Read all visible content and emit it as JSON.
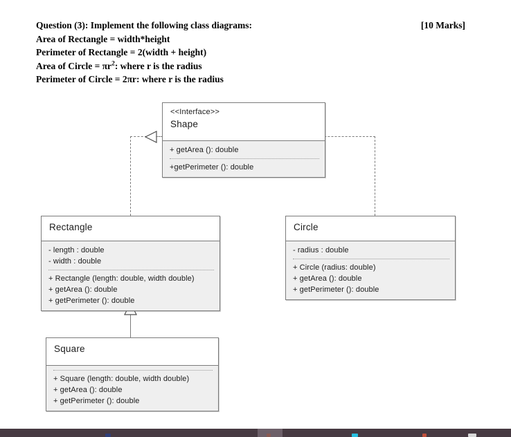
{
  "question": {
    "title": "Question (3): Implement the following class diagrams:",
    "marks": "[10 Marks]",
    "line2": "Area of Rectangle = width*height",
    "line3": "Perimeter of Rectangle = 2(width + height)",
    "line4_prefix": "Area of Circle = πr",
    "line4_sup": "2",
    "line4_suffix": ": where r is the radius",
    "line5": "Perimeter of Circle = 2πr: where r is the radius"
  },
  "diagram": {
    "type": "uml-class-diagram",
    "classes": [
      {
        "id": "shape",
        "stereotype": "<<Interface>>",
        "name": "Shape",
        "attributes": [],
        "methods": [
          "+ getArea (): double",
          "+getPerimeter (): double"
        ]
      },
      {
        "id": "rectangle",
        "stereotype": "",
        "name": "Rectangle",
        "attributes": [
          "- length : double",
          "- width : double"
        ],
        "methods": [
          "+ Rectangle (length: double, width double)",
          "+ getArea (): double",
          "+ getPerimeter (): double"
        ]
      },
      {
        "id": "circle",
        "stereotype": "",
        "name": "Circle",
        "attributes": [
          "- radius : double"
        ],
        "methods": [
          "+ Circle (radius: double)",
          "+ getArea (): double",
          "+ getPerimeter (): double"
        ]
      },
      {
        "id": "square",
        "stereotype": "",
        "name": "Square",
        "attributes": [],
        "methods": [
          "+ Square (length: double, width double)",
          "+ getArea (): double",
          "+ getPerimeter (): double"
        ]
      }
    ],
    "relationships": [
      {
        "from": "Rectangle",
        "to": "Shape",
        "kind": "realization"
      },
      {
        "from": "Circle",
        "to": "Shape",
        "kind": "realization"
      },
      {
        "from": "Square",
        "to": "Rectangle",
        "kind": "generalization"
      }
    ],
    "colors": {
      "border": "#7b7b7b",
      "header_fill": "#ffffff",
      "compartment_fill": "#efefef",
      "text": "#1c1c1c"
    }
  },
  "taskbar": {
    "background": "#473a42",
    "active_window_background": "#6d6069",
    "icons": [
      "window-icon",
      "folder-icon",
      "terminal-icon",
      "browser-icon"
    ]
  }
}
